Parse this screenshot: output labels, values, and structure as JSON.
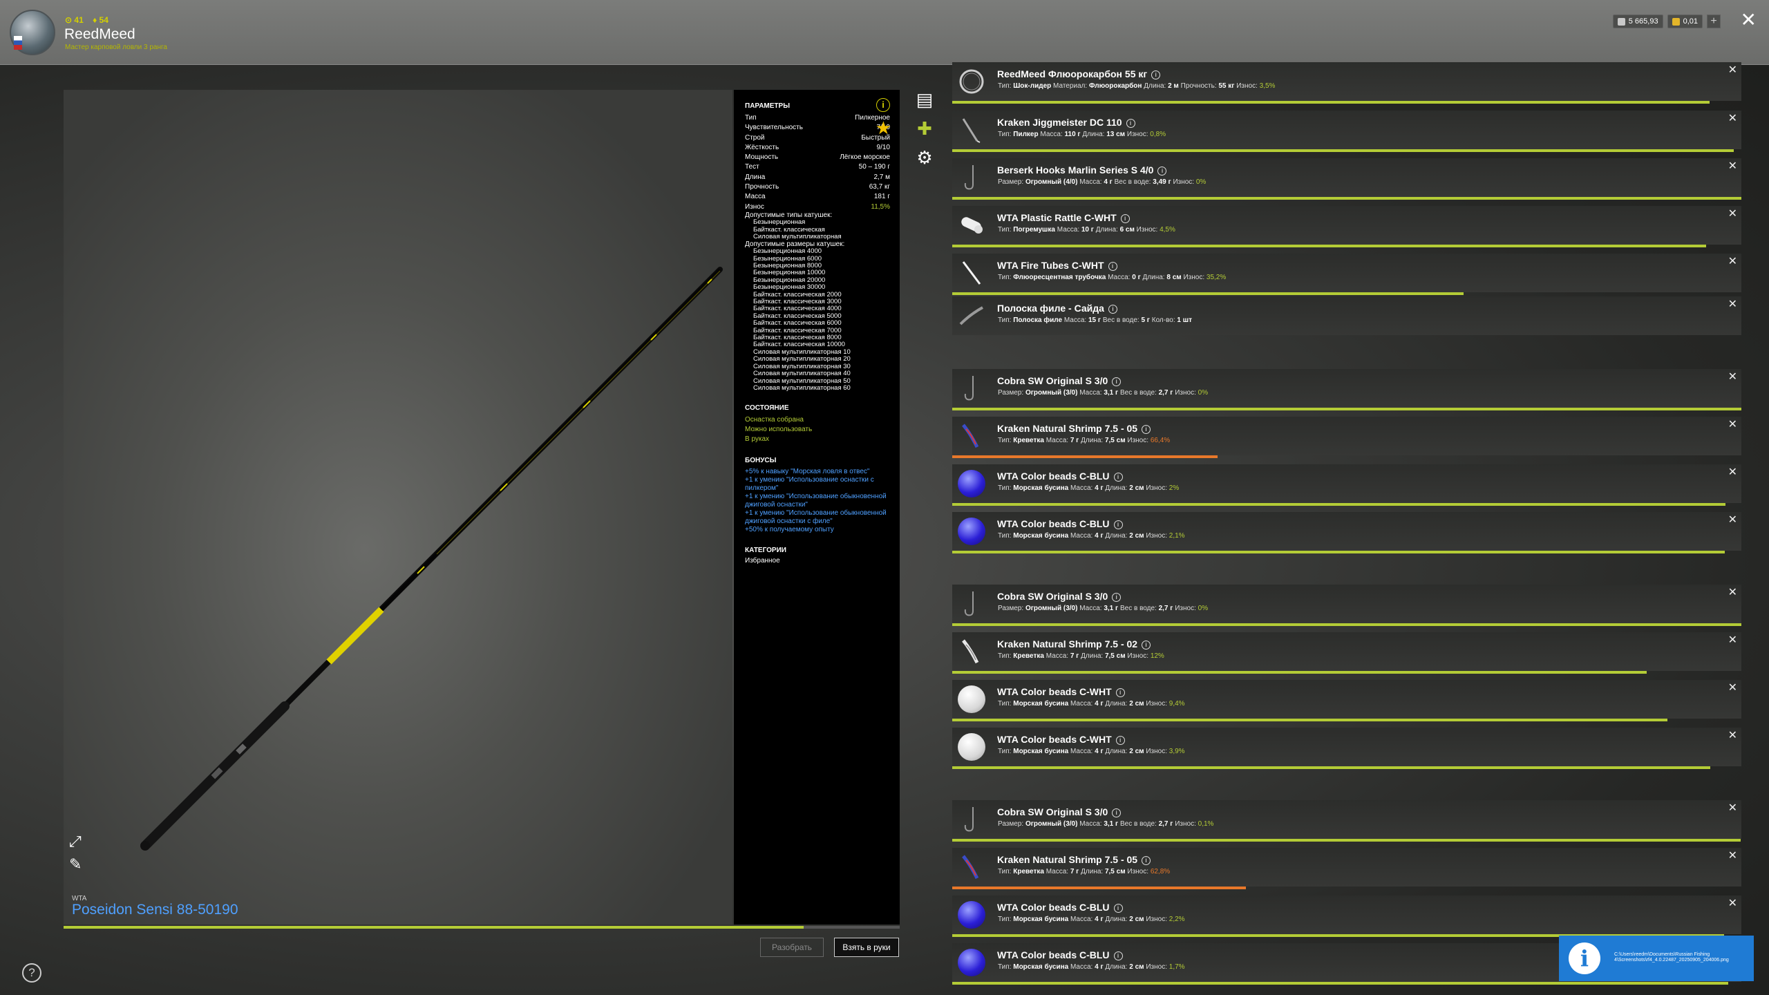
{
  "player": {
    "stat_a": "⊙ 41",
    "stat_b": "♦ 54",
    "name": "ReedMeed",
    "rank": "Мастер карповой ловли 3 ранга"
  },
  "currency": {
    "silver": "5 665,93",
    "gold": "0,01",
    "plus": "+"
  },
  "rod": {
    "brand": "WTA",
    "name": "Poseidon Sensi 88-50190",
    "durability_pct": 0.885
  },
  "params": {
    "title": "ПАРАМЕТРЫ",
    "rows": [
      {
        "k": "Тип",
        "v": "Пилкерное"
      },
      {
        "k": "Чувствительность",
        "v": "7/10"
      },
      {
        "k": "Строй",
        "v": "Быстрый"
      },
      {
        "k": "Жёсткость",
        "v": "9/10"
      },
      {
        "k": "Мощность",
        "v": "Лёгкое морское"
      },
      {
        "k": "Тест",
        "v": "50 – 190 г"
      },
      {
        "k": "Длина",
        "v": "2,7 м"
      },
      {
        "k": "Прочность",
        "v": "63,7 кг"
      },
      {
        "k": "Масса",
        "v": "181 г"
      },
      {
        "k": "Износ",
        "v": "11,5%"
      }
    ],
    "reel_types_title": "Допустимые типы катушек:",
    "reel_types": [
      "Безынерционная",
      "Байткаст. классическая",
      "Силовая мультипликаторная"
    ],
    "reel_sizes_title": "Допустимые размеры катушек:",
    "reel_sizes": [
      "Безынерционная 4000",
      "Безынерционная 6000",
      "Безынерционная 8000",
      "Безынерционная 10000",
      "Безынерционная 20000",
      "Безынерционная 30000",
      "Байткаст. классическая 2000",
      "Байткаст. классическая 3000",
      "Байткаст. классическая 4000",
      "Байткаст. классическая 5000",
      "Байткаст. классическая 6000",
      "Байткаст. классическая 7000",
      "Байткаст. классическая 8000",
      "Байткаст. классическая 10000",
      "Силовая мультипликаторная 10",
      "Силовая мультипликаторная 20",
      "Силовая мультипликаторная 30",
      "Силовая мультипликаторная 40",
      "Силовая мультипликаторная 50",
      "Силовая мультипликаторная 60"
    ],
    "state_title": "СОСТОЯНИЕ",
    "state": [
      "Оснастка собрана",
      "Можно использовать",
      "В руках"
    ],
    "bonus_title": "БОНУСЫ",
    "bonuses": [
      "+5% к навыку \"Морская ловля в отвес\"",
      "+1 к умению \"Использование оснастки с пилкером\"",
      "+1 к умению \"Использование обыкновенной джиговой оснастки\"",
      "+1 к умению \"Использование обыкновенной джиговой оснастки с филе\"",
      "+50% к получаемому опыту"
    ],
    "cat_title": "КАТЕГОРИИ",
    "category": "Избранное",
    "info_glyph": "i",
    "star_glyph": "★"
  },
  "buttons": {
    "disassemble": "Разобрать",
    "take": "Взять в руки"
  },
  "icons": {
    "close": "✕",
    "expand": "⤢",
    "edit": "✎",
    "help": "?",
    "x": "✕",
    "info": "i"
  },
  "items": [
    {
      "name": "ReedMeed Флюорокарбон 55 кг",
      "thumb": "line",
      "desc": [
        [
          "Тип:",
          "Шок-лидер"
        ],
        [
          "Материал:",
          "Флюорокарбон"
        ],
        [
          "Длина:",
          "2 м"
        ],
        [
          "Прочность:",
          "55 кг"
        ]
      ],
      "wear_label": "Износ:",
      "wear": "3,5%",
      "wear_fill": 0.96,
      "orange": false
    },
    {
      "name": "Kraken Jiggmeister DC 110",
      "thumb": "jig",
      "desc": [
        [
          "Тип:",
          "Пилкер"
        ],
        [
          "Масса:",
          "110 г"
        ],
        [
          "Длина:",
          "13 см"
        ]
      ],
      "wear_label": "Износ:",
      "wear": "0,8%",
      "wear_fill": 0.99,
      "orange": false
    },
    {
      "name": "Berserk Hooks Marlin Series S 4/0",
      "thumb": "hook",
      "desc": [
        [
          "Размер:",
          "Огромный (4/0)"
        ],
        [
          "Масса:",
          "4 г"
        ],
        [
          "Вес в воде:",
          "3,49 г"
        ]
      ],
      "wear_label": "Износ:",
      "wear": "0%",
      "wear_fill": 1.0,
      "orange": false
    },
    {
      "name": "WTA Plastic Rattle C-WHT",
      "thumb": "rattle",
      "desc": [
        [
          "Тип:",
          "Погремушка"
        ],
        [
          "Масса:",
          "10 г"
        ],
        [
          "Длина:",
          "6 см"
        ]
      ],
      "wear_label": "Износ:",
      "wear": "4,5%",
      "wear_fill": 0.955,
      "orange": false
    },
    {
      "name": "WTA Fire Tubes C-WHT",
      "thumb": "tube",
      "desc": [
        [
          "Тип:",
          "Флюоресцентная трубочка"
        ],
        [
          "Масса:",
          "0 г"
        ],
        [
          "Длина:",
          "8 см"
        ]
      ],
      "wear_label": "Износ:",
      "wear": "35,2%",
      "wear_fill": 0.648,
      "orange": false
    },
    {
      "name": "Полоска филе - Сайда",
      "thumb": "fillet",
      "desc": [
        [
          "Тип:",
          "Полоска филе"
        ],
        [
          "Масса:",
          "15 г"
        ],
        [
          "Вес в воде:",
          "5 г"
        ],
        [
          "Кол-во:",
          "1 шт"
        ]
      ],
      "wear_label": "",
      "wear": "",
      "wear_fill": 0,
      "orange": false
    },
    {
      "name": "Cobra SW Original S 3/0",
      "thumb": "hook",
      "desc": [
        [
          "Размер:",
          "Огромный (3/0)"
        ],
        [
          "Масса:",
          "3,1 г"
        ],
        [
          "Вес в воде:",
          "2,7 г"
        ]
      ],
      "wear_label": "Износ:",
      "wear": "0%",
      "wear_fill": 1.0,
      "orange": false
    },
    {
      "name": "Kraken Natural Shrimp 7.5 - 05",
      "thumb": "shrimp-blue",
      "desc": [
        [
          "Тип:",
          "Креветка"
        ],
        [
          "Масса:",
          "7 г"
        ],
        [
          "Длина:",
          "7,5 см"
        ]
      ],
      "wear_label": "Износ:",
      "wear": "66,4%",
      "wear_fill": 0.336,
      "orange": true
    },
    {
      "name": "WTA Color beads C-BLU",
      "thumb": "bead-blue",
      "desc": [
        [
          "Тип:",
          "Морская бусина"
        ],
        [
          "Масса:",
          "4 г"
        ],
        [
          "Длина:",
          "2 см"
        ]
      ],
      "wear_label": "Износ:",
      "wear": "2%",
      "wear_fill": 0.98,
      "orange": false
    },
    {
      "name": "WTA Color beads C-BLU",
      "thumb": "bead-blue",
      "desc": [
        [
          "Тип:",
          "Морская бусина"
        ],
        [
          "Масса:",
          "4 г"
        ],
        [
          "Длина:",
          "2 см"
        ]
      ],
      "wear_label": "Износ:",
      "wear": "2,1%",
      "wear_fill": 0.979,
      "orange": false
    },
    {
      "name": "Cobra SW Original S 3/0",
      "thumb": "hook",
      "desc": [
        [
          "Размер:",
          "Огромный (3/0)"
        ],
        [
          "Масса:",
          "3,1 г"
        ],
        [
          "Вес в воде:",
          "2,7 г"
        ]
      ],
      "wear_label": "Износ:",
      "wear": "0%",
      "wear_fill": 1.0,
      "orange": false
    },
    {
      "name": "Kraken Natural Shrimp 7.5 - 02",
      "thumb": "shrimp-white",
      "desc": [
        [
          "Тип:",
          "Креветка"
        ],
        [
          "Масса:",
          "7 г"
        ],
        [
          "Длина:",
          "7,5 см"
        ]
      ],
      "wear_label": "Износ:",
      "wear": "12%",
      "wear_fill": 0.88,
      "orange": false
    },
    {
      "name": "WTA Color beads C-WHT",
      "thumb": "bead-white",
      "desc": [
        [
          "Тип:",
          "Морская бусина"
        ],
        [
          "Масса:",
          "4 г"
        ],
        [
          "Длина:",
          "2 см"
        ]
      ],
      "wear_label": "Износ:",
      "wear": "9,4%",
      "wear_fill": 0.906,
      "orange": false
    },
    {
      "name": "WTA Color beads C-WHT",
      "thumb": "bead-white",
      "desc": [
        [
          "Тип:",
          "Морская бусина"
        ],
        [
          "Масса:",
          "4 г"
        ],
        [
          "Длина:",
          "2 см"
        ]
      ],
      "wear_label": "Износ:",
      "wear": "3,9%",
      "wear_fill": 0.961,
      "orange": false
    },
    {
      "name": "Cobra SW Original S 3/0",
      "thumb": "hook",
      "desc": [
        [
          "Размер:",
          "Огромный (3/0)"
        ],
        [
          "Масса:",
          "3,1 г"
        ],
        [
          "Вес в воде:",
          "2,7 г"
        ]
      ],
      "wear_label": "Износ:",
      "wear": "0,1%",
      "wear_fill": 0.999,
      "orange": false
    },
    {
      "name": "Kraken Natural Shrimp 7.5 - 05",
      "thumb": "shrimp-blue",
      "desc": [
        [
          "Тип:",
          "Креветка"
        ],
        [
          "Масса:",
          "7 г"
        ],
        [
          "Длина:",
          "7,5 см"
        ]
      ],
      "wear_label": "Износ:",
      "wear": "62,8%",
      "wear_fill": 0.372,
      "orange": true
    },
    {
      "name": "WTA Color beads C-BLU",
      "thumb": "bead-blue",
      "desc": [
        [
          "Тип:",
          "Морская бусина"
        ],
        [
          "Масса:",
          "4 г"
        ],
        [
          "Длина:",
          "2 см"
        ]
      ],
      "wear_label": "Износ:",
      "wear": "2,2%",
      "wear_fill": 0.978,
      "orange": false
    },
    {
      "name": "WTA Color beads C-BLU",
      "thumb": "bead-blue",
      "desc": [
        [
          "Тип:",
          "Морская бусина"
        ],
        [
          "Масса:",
          "4 г"
        ],
        [
          "Длина:",
          "2 см"
        ]
      ],
      "wear_label": "Износ:",
      "wear": "1,7%",
      "wear_fill": 0.983,
      "orange": false
    }
  ],
  "notification": {
    "text": "C:\\Users\\reedm\\Documents\\Russian Fishing 4\\Screenshots\\rf4_4.0.22487_20250905_204006.png"
  },
  "colors": {
    "accent_green": "#b4cc36",
    "wear_orange": "#e8782a",
    "link_blue": "#4fa0ff",
    "notif_blue": "#1f7bd4"
  }
}
